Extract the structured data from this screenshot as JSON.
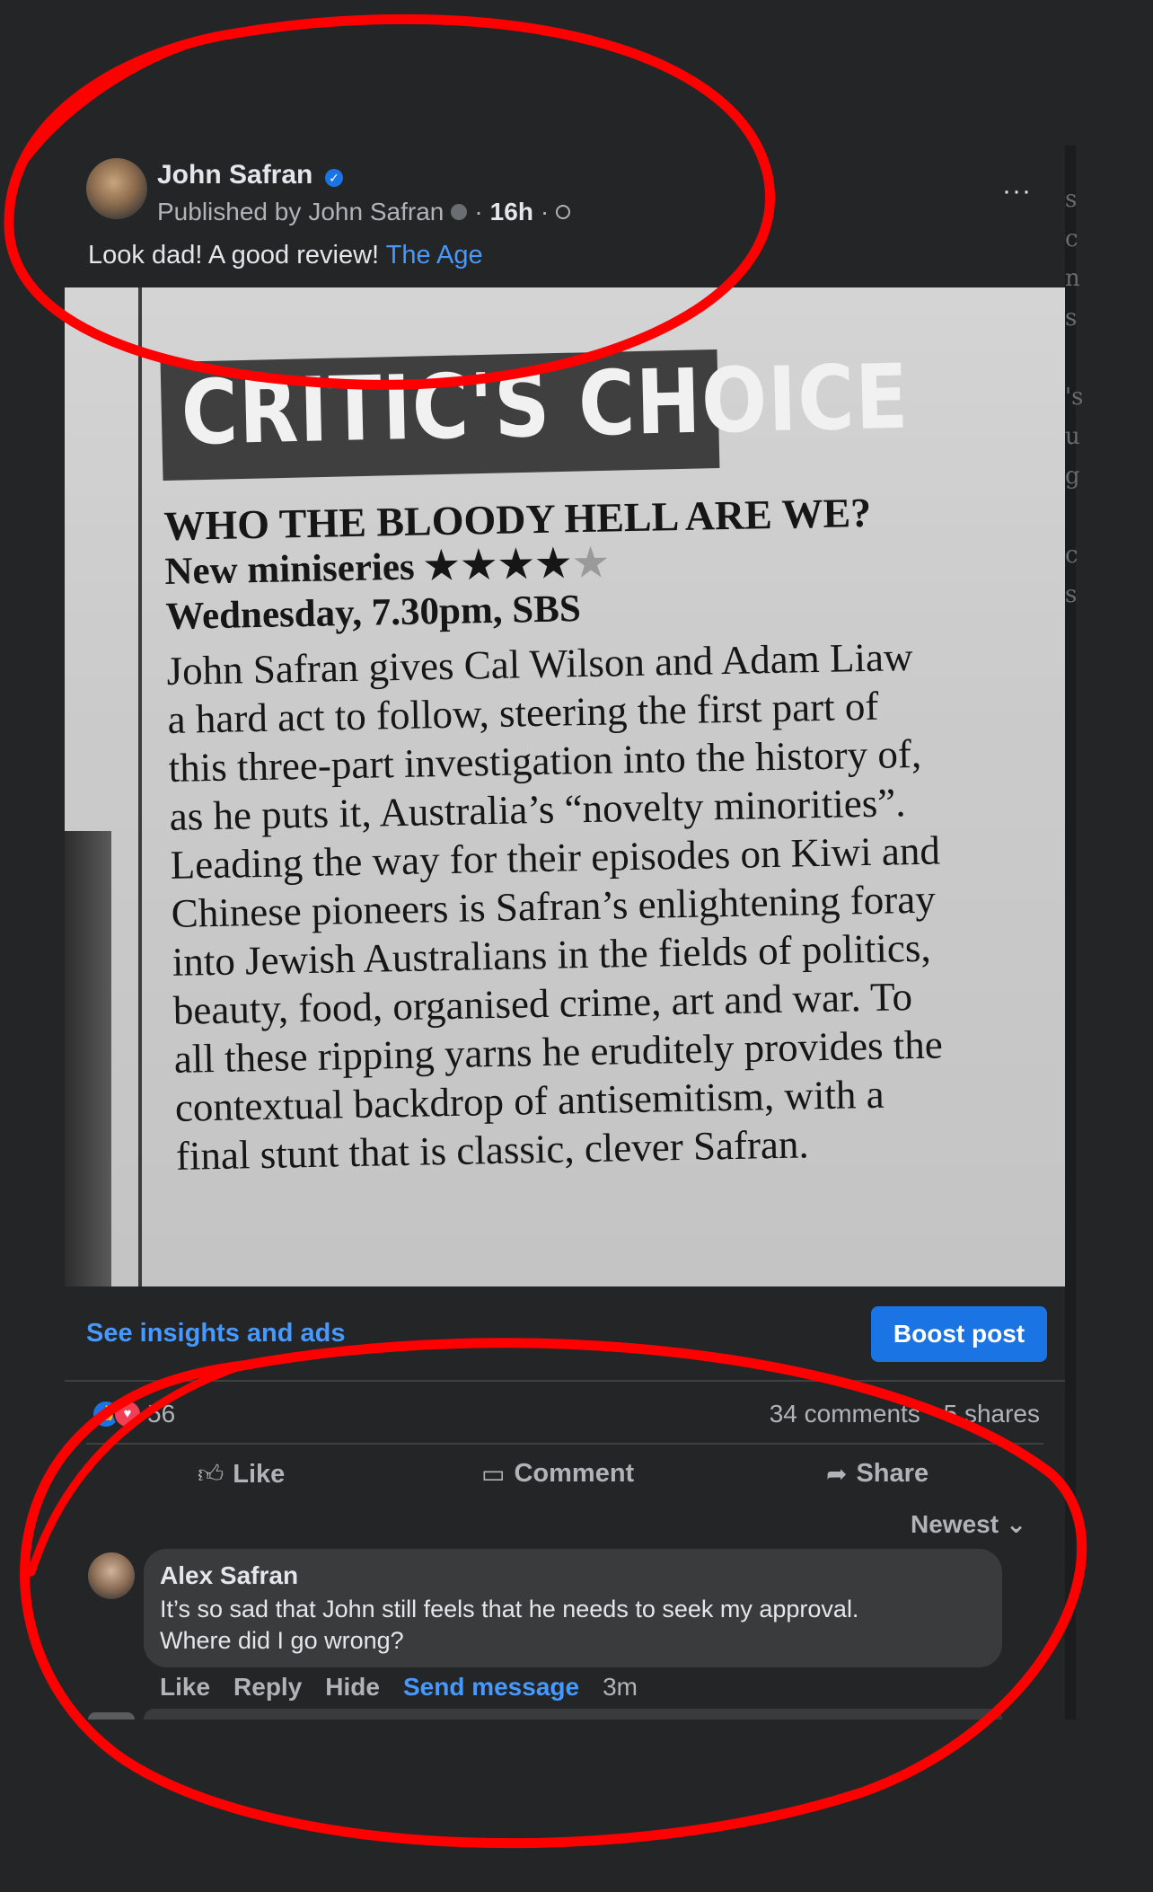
{
  "post": {
    "author": "John Safran",
    "byline_prefix": "Published by",
    "byline_name": "John Safran",
    "time": "16h",
    "sep": "·",
    "caption": "Look dad! A good review!",
    "caption_link": "The Age",
    "more": "···"
  },
  "clipping": {
    "banner": "CRITIC'S CHOICE",
    "headline": "WHO THE BLOODY HELL ARE WE?",
    "meta_line1": "New miniseries",
    "stars_full": "★★★★",
    "stars_empty": "★",
    "rating": 4,
    "rating_max": 5,
    "meta_line2": "Wednesday, 7.30pm, SBS",
    "body": [
      "John Safran gives Cal Wilson and Adam Liaw",
      "a hard act to follow, steering the first part of",
      "this three-part investigation into the history of,",
      "as he puts it, Australia’s “novelty minorities”.",
      "Leading the way for their episodes on Kiwi and",
      "Chinese pioneers is Safran’s enlightening foray",
      "into Jewish Australians in the fields of politics,",
      "beauty, food, organised crime, art and war. To",
      "all these ripping yarns he eruditely provides the",
      "contextual backdrop of antisemitism, with a",
      "final stunt that is classic, clever Safran."
    ]
  },
  "insights": {
    "link": "See insights and ads",
    "boost": "Boost post"
  },
  "stats": {
    "reactions": "56",
    "comments": "34 comments",
    "shares": "5 shares"
  },
  "actions": {
    "like": "Like",
    "comment": "Comment",
    "share": "Share"
  },
  "sort": {
    "label": "Newest"
  },
  "comment": {
    "name": "Alex Safran",
    "text_line1": "It’s so sad that John still feels that he needs to seek my approval.",
    "text_line2": "Where did I go wrong?",
    "like": "Like",
    "reply": "Reply",
    "hide": "Hide",
    "send": "Send message",
    "time": "3m"
  },
  "side_letters": [
    "s",
    "c",
    "n",
    "s",
    "",
    "'s",
    "u",
    "g",
    "",
    "c",
    "s"
  ],
  "colors": {
    "background": "#242526",
    "link_blue": "#4599ff",
    "button_blue": "#1b74e4",
    "annotation_red": "#ff0000"
  }
}
